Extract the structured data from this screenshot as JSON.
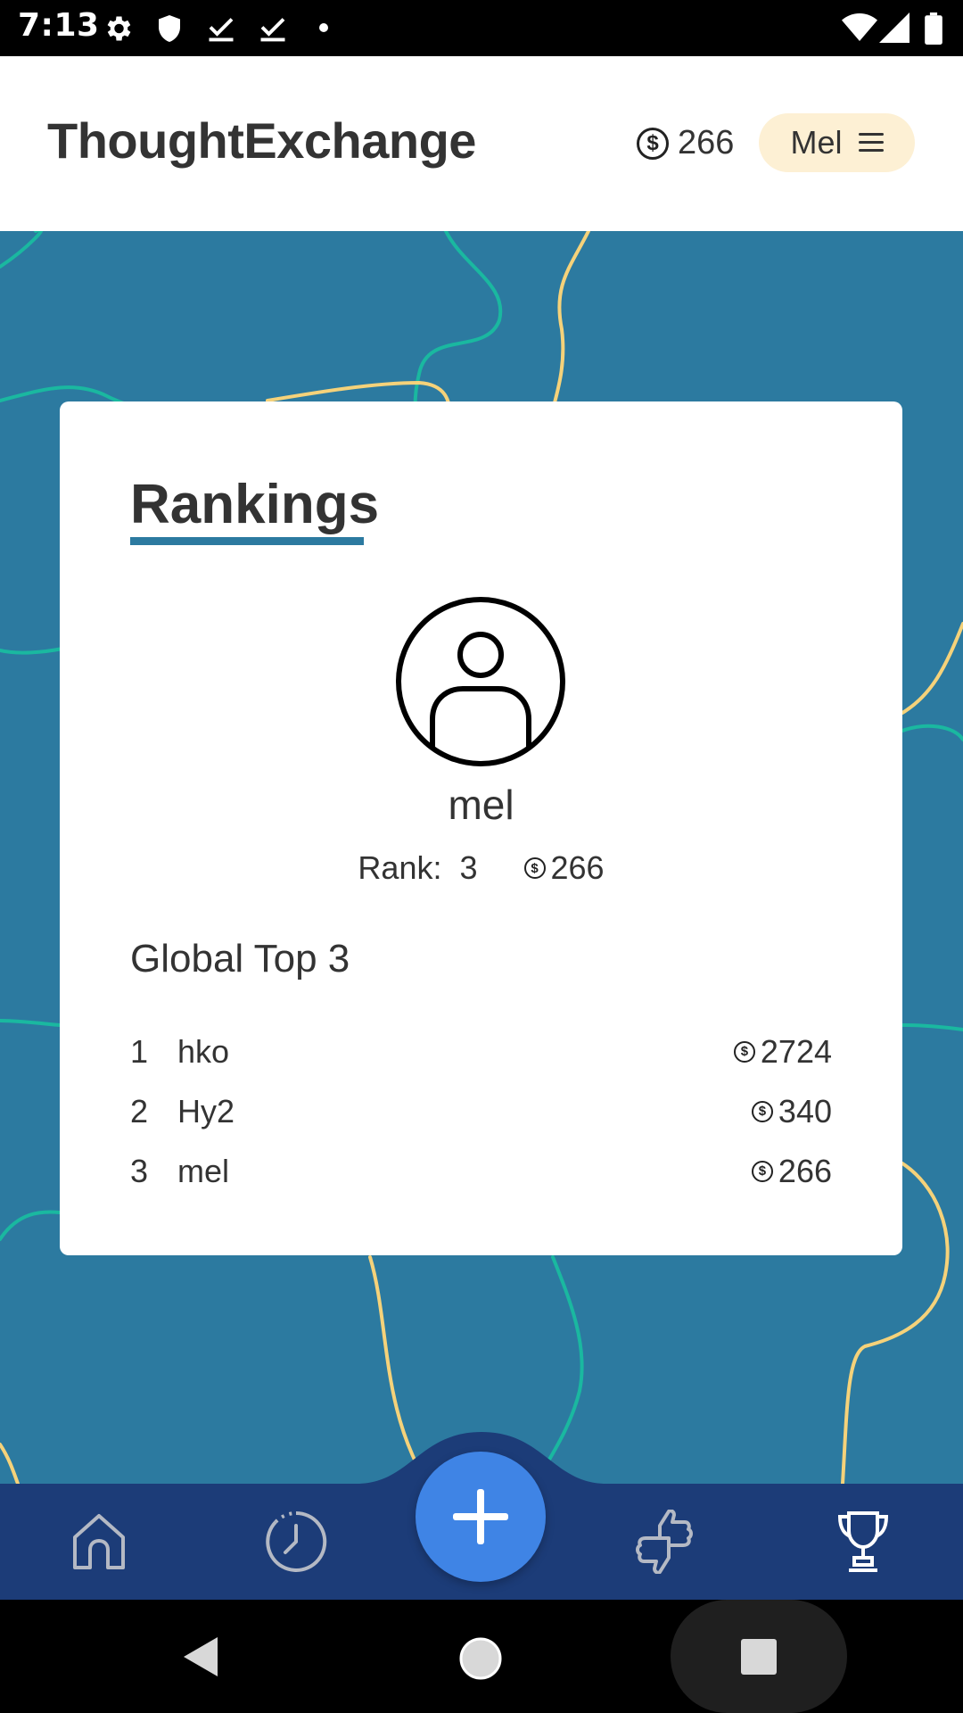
{
  "status_bar": {
    "time": "7:13",
    "icons": [
      "gear-icon",
      "shield-icon",
      "check-download-icon",
      "check-download-icon",
      "dot-icon",
      "wifi-icon",
      "signal-icon",
      "battery-icon"
    ]
  },
  "header": {
    "title": "ThoughtExchange",
    "coin_balance": "266",
    "user_label": "Mel",
    "coin_symbol": "$"
  },
  "rankings": {
    "title": "Rankings",
    "profile_name": "mel",
    "rank_label": "Rank:",
    "rank_value": "3",
    "coins": "266",
    "section_title": "Global Top 3",
    "leaders": [
      {
        "pos": "1",
        "name": "hko",
        "score": "2724"
      },
      {
        "pos": "2",
        "name": "Hy2",
        "score": "340"
      },
      {
        "pos": "3",
        "name": "mel",
        "score": "266"
      }
    ]
  },
  "bottom_nav": {
    "items": [
      "home-icon",
      "history-clock-icon",
      "add-icon",
      "thumbs-vote-icon",
      "trophy-icon"
    ]
  },
  "colors": {
    "brand_blue": "#2c7aa0",
    "nav_dark": "#1c3c78",
    "fab_blue": "#3f84e5",
    "user_chip": "#fdf0d4",
    "line_teal": "#1ab8a0",
    "line_yellow": "#f5d27a"
  }
}
